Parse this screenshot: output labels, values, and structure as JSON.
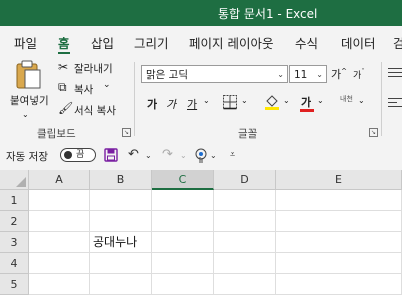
{
  "window": {
    "title": "통합 문서1  -  Excel"
  },
  "tabs": [
    "파일",
    "홈",
    "삽입",
    "그리기",
    "페이지 레이아웃",
    "수식",
    "데이터",
    "검"
  ],
  "active_tab": "홈",
  "clipboard": {
    "paste_label": "붙여넣기",
    "cut_label": "잘라내기",
    "copy_label": "복사",
    "format_painter_label": "서식 복사",
    "group_label": "클립보드"
  },
  "font": {
    "font_name": "맑은 고딕",
    "font_size": "11",
    "grow": "가",
    "shrink": "가",
    "bold": "가",
    "italic": "가",
    "underline": "가",
    "font_color_glyph": "가",
    "phonetic": "내천",
    "group_label": "글꼴",
    "font_color": "#e02020",
    "fill_color": "#ffe600"
  },
  "qat": {
    "autosave_label": "자동 저장",
    "autosave_state": "끔"
  },
  "sheet": {
    "columns": [
      "A",
      "B",
      "C",
      "D",
      "E"
    ],
    "selected_column": "C",
    "rows": [
      "1",
      "2",
      "3",
      "4",
      "5"
    ],
    "cells": {
      "B3": "공대누나"
    }
  }
}
